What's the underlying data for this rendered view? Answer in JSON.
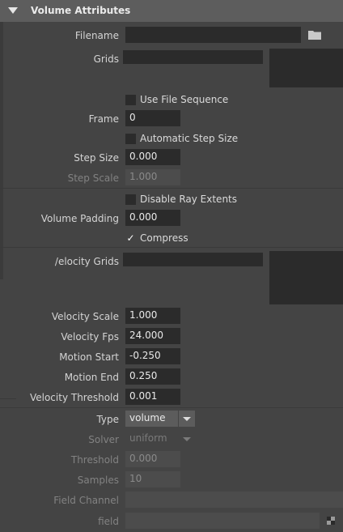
{
  "header": {
    "title": "Volume Attributes"
  },
  "filename": {
    "label": "Filename",
    "value": ""
  },
  "grids": {
    "label": "Grids"
  },
  "use_file_sequence": {
    "label": "Use File Sequence",
    "checked": false
  },
  "frame": {
    "label": "Frame",
    "value": "0"
  },
  "automatic_step_size": {
    "label": "Automatic Step Size",
    "checked": false
  },
  "step_size": {
    "label": "Step Size",
    "value": "0.000"
  },
  "step_scale": {
    "label": "Step Scale",
    "value": "1.000"
  },
  "disable_ray_extents": {
    "label": "Disable Ray Extents",
    "checked": false
  },
  "volume_padding": {
    "label": "Volume Padding",
    "value": "0.000"
  },
  "compress": {
    "label": "Compress",
    "checked": true,
    "checkmark": "✓"
  },
  "velocity_grids": {
    "label": "/elocity Grids"
  },
  "velocity_scale": {
    "label": "Velocity Scale",
    "value": "1.000"
  },
  "velocity_fps": {
    "label": "Velocity Fps",
    "value": "24.000"
  },
  "motion_start": {
    "label": "Motion Start",
    "value": "-0.250"
  },
  "motion_end": {
    "label": "Motion End",
    "value": "0.250"
  },
  "velocity_threshold": {
    "label": "Velocity Threshold",
    "value": "0.001"
  },
  "type": {
    "label": "Type",
    "value": "volume"
  },
  "solver": {
    "label": "Solver",
    "value": "uniform"
  },
  "threshold": {
    "label": "Threshold",
    "value": "0.000"
  },
  "samples": {
    "label": "Samples",
    "value": "10"
  },
  "field_channel": {
    "label": "Field Channel",
    "value": ""
  },
  "field": {
    "label": "field",
    "value": ""
  },
  "icons": {
    "folder": "folder-icon",
    "checker": "checker-icon",
    "collapse": "triangle-down-icon"
  }
}
